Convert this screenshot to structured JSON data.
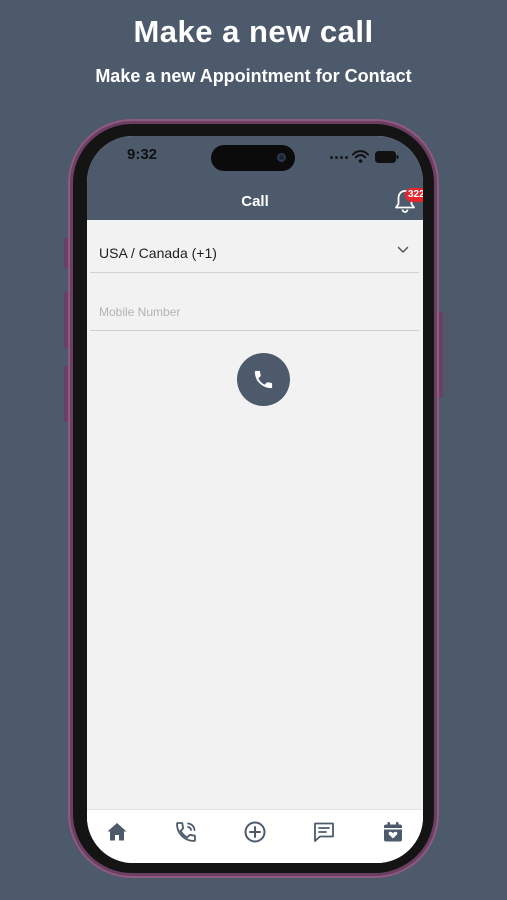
{
  "promo": {
    "headline": "Make a new call",
    "subheadline": "Make a new Appointment for Contact"
  },
  "status_bar": {
    "time": "9:32",
    "icons": [
      "signal-icon",
      "wifi-icon",
      "battery-icon"
    ]
  },
  "header": {
    "title": "Call",
    "notification_icon": "bell-icon",
    "notification_count": "322"
  },
  "form": {
    "country_value": "USA / Canada (+1)",
    "country_icon": "chevron-down-icon",
    "mobile_value": "",
    "mobile_placeholder": "Mobile Number",
    "call_icon": "phone-icon"
  },
  "tabs": [
    {
      "icon": "home-icon"
    },
    {
      "icon": "phone-call-icon"
    },
    {
      "icon": "add-circle-icon"
    },
    {
      "icon": "message-icon"
    },
    {
      "icon": "calendar-heart-icon"
    }
  ],
  "colors": {
    "brand": "#4c5a6c",
    "background": "#f2f2f2",
    "badge": "#e8262b",
    "phone_frame": "#6b3f61"
  }
}
